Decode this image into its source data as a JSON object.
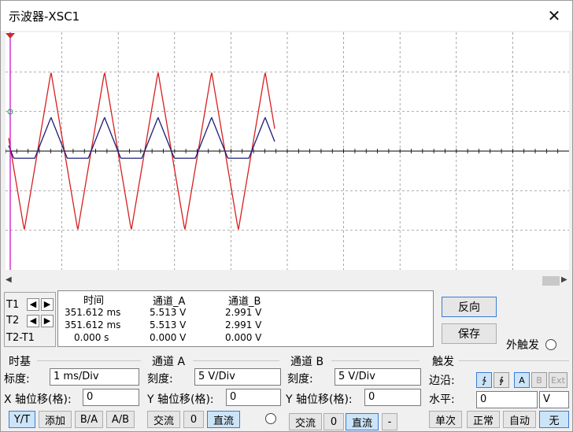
{
  "window": {
    "title": "示波器-XSC1",
    "close_glyph": "✕"
  },
  "scope": {
    "background": "#000000",
    "grid_color": "#808080",
    "channel_a_color": "#d81e1e",
    "channel_b_color": "#1b1b7a",
    "channel_a_amplitude_div": 2.0,
    "channel_b_amplitude_div": 0.85,
    "channel_b_clip_div": -0.18
  },
  "scroll": {
    "left_glyph": "◀",
    "right_glyph": "▶"
  },
  "cursors": {
    "t1_label": "T1",
    "t2_label": "T2",
    "diff_label": "T2-T1",
    "left_glyph": "◀",
    "right_glyph": "▶"
  },
  "readout": {
    "headers": [
      "时间",
      "通道_A",
      "通道_B"
    ],
    "rows": [
      [
        "351.612 ms",
        "5.513 V",
        "2.991 V"
      ],
      [
        "351.612 ms",
        "5.513 V",
        "2.991 V"
      ],
      [
        "0.000 s",
        "0.000 V",
        "0.000 V"
      ]
    ]
  },
  "actions": {
    "reverse": "反向",
    "save": "保存",
    "ext_trigger": "外触发"
  },
  "timebase": {
    "title": "时基",
    "scale_label": "标度:",
    "scale_value": "1 ms/Div",
    "xpos_label": "X 轴位移(格):",
    "xpos_value": "0",
    "modes": [
      "Y/T",
      "添加",
      "B/A",
      "A/B"
    ]
  },
  "channel_a": {
    "title": "通道 A",
    "scale_label": "刻度:",
    "scale_value": "5  V/Div",
    "ypos_label": "Y 轴位移(格):",
    "ypos_value": "0",
    "coupling": [
      "交流",
      "0",
      "直流"
    ]
  },
  "channel_b": {
    "title": "通道 B",
    "scale_label": "刻度:",
    "scale_value": "5  V/Div",
    "ypos_label": "Y 轴位移(格):",
    "ypos_value": "0",
    "coupling": [
      "交流",
      "0",
      "直流",
      "-"
    ]
  },
  "trigger": {
    "title": "触发",
    "edge_label": "边沿:",
    "edge_buttons": [
      "∱",
      "∲"
    ],
    "source_buttons": [
      "A",
      "B",
      "Ext"
    ],
    "level_label": "水平:",
    "level_value": "0",
    "level_unit": "V",
    "modes": [
      "单次",
      "正常",
      "自动",
      "无"
    ]
  }
}
